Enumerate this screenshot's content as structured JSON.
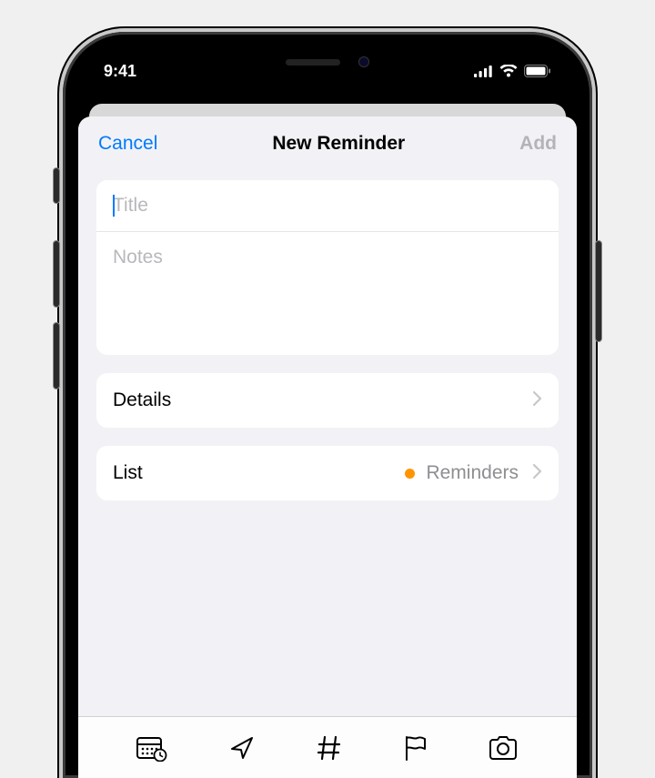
{
  "status_bar": {
    "time": "9:41"
  },
  "nav": {
    "cancel_label": "Cancel",
    "title": "New Reminder",
    "add_label": "Add"
  },
  "form": {
    "title_placeholder": "Title",
    "title_value": "",
    "notes_placeholder": "Notes",
    "notes_value": ""
  },
  "details": {
    "label": "Details"
  },
  "list": {
    "label": "List",
    "selected_name": "Reminders",
    "selected_color": "#ff9500"
  }
}
